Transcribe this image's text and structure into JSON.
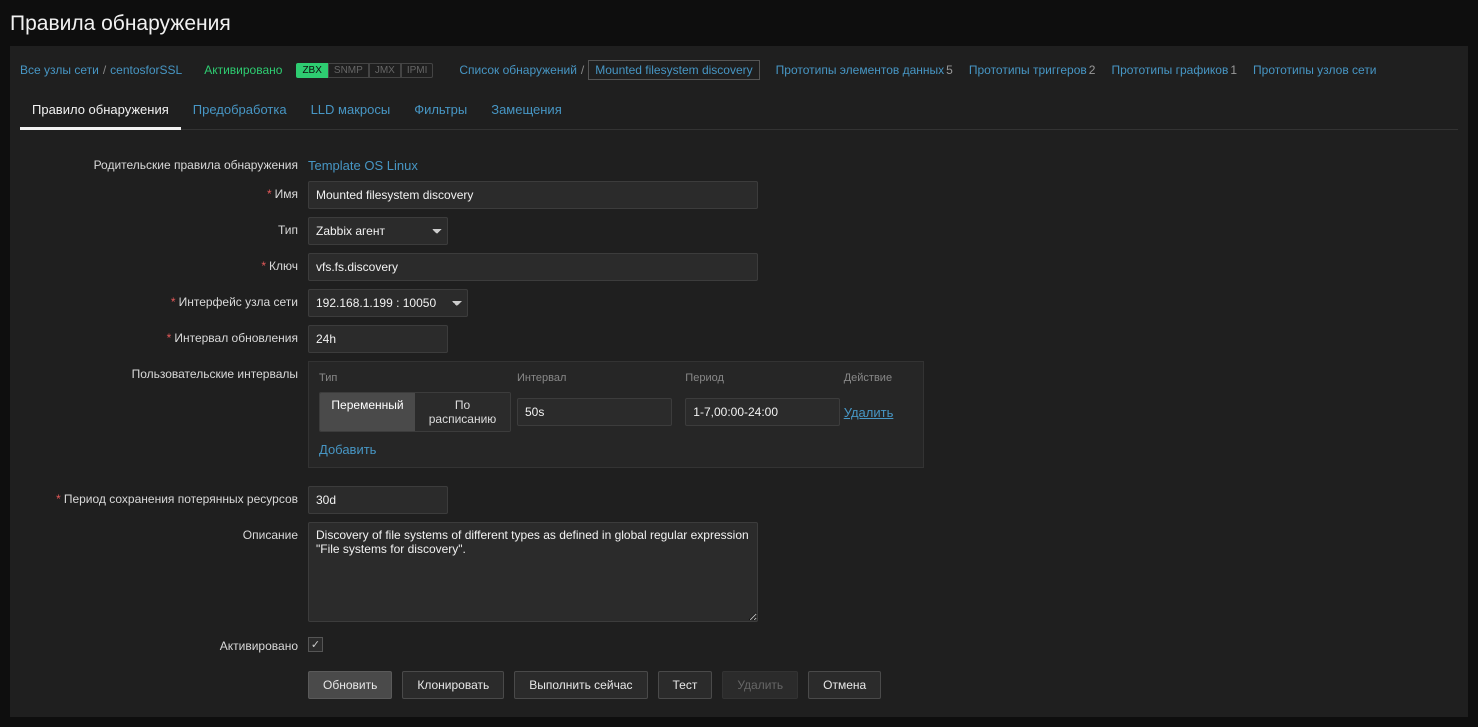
{
  "page_title": "Правила обнаружения",
  "breadcrumb": {
    "all_hosts": "Все узлы сети",
    "host": "centosforSSL",
    "status": "Активировано",
    "badges": {
      "zbx": "ZBX",
      "snmp": "SNMP",
      "jmx": "JMX",
      "ipmi": "IPMI"
    },
    "discovery_list": "Список обнаружений",
    "current": "Mounted filesystem discovery",
    "proto_items": "Прототипы элементов данных",
    "proto_items_count": "5",
    "proto_triggers": "Прототипы триггеров",
    "proto_triggers_count": "2",
    "proto_graphs": "Прототипы графиков",
    "proto_graphs_count": "1",
    "proto_hosts": "Прототипы узлов сети"
  },
  "tabs": {
    "rule": "Правило обнаружения",
    "preproc": "Предобработка",
    "lld": "LLD макросы",
    "filters": "Фильтры",
    "overrides": "Замещения"
  },
  "form": {
    "parent_label": "Родительские правила обнаружения",
    "parent_value": "Template OS Linux",
    "name_label": "Имя",
    "name_value": "Mounted filesystem discovery",
    "type_label": "Тип",
    "type_value": "Zabbix агент",
    "key_label": "Ключ",
    "key_value": "vfs.fs.discovery",
    "iface_label": "Интерфейс узла сети",
    "iface_value": "192.168.1.199 : 10050",
    "interval_label": "Интервал обновления",
    "interval_value": "24h",
    "custom_intervals_label": "Пользовательские интервалы",
    "keep_lost_label": "Период сохранения потерянных ресурсов",
    "keep_lost_value": "30d",
    "desc_label": "Описание",
    "desc_value": "Discovery of file systems of different types as defined in global regular expression \"File systems for discovery\".",
    "enabled_label": "Активировано"
  },
  "intervals": {
    "hdr_type": "Тип",
    "hdr_int": "Интервал",
    "hdr_per": "Период",
    "hdr_act": "Действие",
    "seg_flexible": "Переменный",
    "seg_scheduled": "По расписанию",
    "row_int": "50s",
    "row_per": "1-7,00:00-24:00",
    "del": "Удалить",
    "add": "Добавить"
  },
  "buttons": {
    "update": "Обновить",
    "clone": "Клонировать",
    "execute": "Выполнить сейчас",
    "test": "Тест",
    "delete": "Удалить",
    "cancel": "Отмена"
  }
}
